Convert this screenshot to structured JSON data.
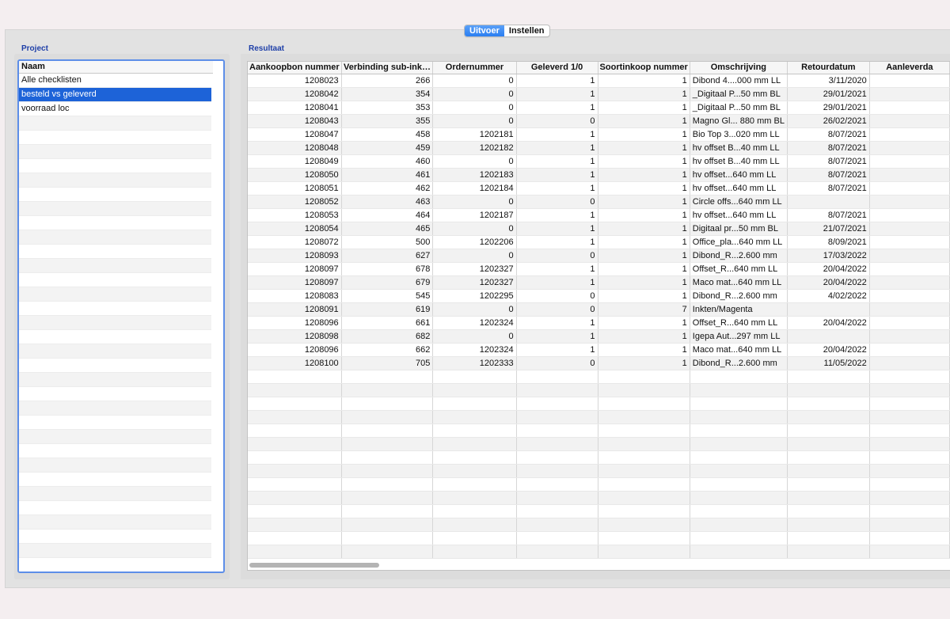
{
  "tabs": [
    {
      "label": "Uitvoer",
      "active": true
    },
    {
      "label": "Instellen",
      "active": false
    }
  ],
  "project": {
    "title": "Project",
    "column_header": "Naam",
    "items": [
      "Alle checklisten",
      "besteld vs geleverd",
      "voorraad loc"
    ],
    "selected_index": 1
  },
  "result": {
    "title": "Resultaat",
    "columns": [
      "Aankoopbon nummer",
      "Verbinding sub-ink…",
      "Ordernummer",
      "Geleverd 1/0",
      "Soortinkoop nummer",
      "Omschrijving",
      "Retourdatum",
      "Aanleverda"
    ],
    "rows": [
      [
        "1208023",
        "266",
        "0",
        "1",
        "1",
        "Dibond 4....000 mm LL",
        "3/11/2020",
        ""
      ],
      [
        "1208042",
        "354",
        "0",
        "1",
        "1",
        "_Digitaal P...50 mm BL",
        "29/01/2021",
        ""
      ],
      [
        "1208041",
        "353",
        "0",
        "1",
        "1",
        "_Digitaal P...50 mm BL",
        "29/01/2021",
        ""
      ],
      [
        "1208043",
        "355",
        "0",
        "0",
        "1",
        "Magno Gl... 880 mm BL",
        "26/02/2021",
        ""
      ],
      [
        "1208047",
        "458",
        "1202181",
        "1",
        "1",
        "Bio Top 3...020 mm LL",
        "8/07/2021",
        ""
      ],
      [
        "1208048",
        "459",
        "1202182",
        "1",
        "1",
        "hv offset B...40 mm LL",
        "8/07/2021",
        ""
      ],
      [
        "1208049",
        "460",
        "0",
        "1",
        "1",
        "hv offset B...40 mm LL",
        "8/07/2021",
        ""
      ],
      [
        "1208050",
        "461",
        "1202183",
        "1",
        "1",
        "hv offset...640 mm LL",
        "8/07/2021",
        ""
      ],
      [
        "1208051",
        "462",
        "1202184",
        "1",
        "1",
        "hv offset...640 mm LL",
        "8/07/2021",
        ""
      ],
      [
        "1208052",
        "463",
        "0",
        "0",
        "1",
        "Circle offs...640 mm LL",
        "",
        ""
      ],
      [
        "1208053",
        "464",
        "1202187",
        "1",
        "1",
        "hv offset...640 mm LL",
        "8/07/2021",
        ""
      ],
      [
        "1208054",
        "465",
        "0",
        "1",
        "1",
        "Digitaal pr...50 mm BL",
        "21/07/2021",
        ""
      ],
      [
        "1208072",
        "500",
        "1202206",
        "1",
        "1",
        "Office_pla...640 mm LL",
        "8/09/2021",
        ""
      ],
      [
        "1208093",
        "627",
        "0",
        "0",
        "1",
        "Dibond_R...2.600 mm",
        "17/03/2022",
        ""
      ],
      [
        "1208097",
        "678",
        "1202327",
        "1",
        "1",
        "Offset_R...640 mm LL",
        "20/04/2022",
        ""
      ],
      [
        "1208097",
        "679",
        "1202327",
        "1",
        "1",
        "Maco mat...640 mm LL",
        "20/04/2022",
        ""
      ],
      [
        "1208083",
        "545",
        "1202295",
        "0",
        "1",
        "Dibond_R...2.600 mm",
        "4/02/2022",
        ""
      ],
      [
        "1208091",
        "619",
        "0",
        "0",
        "7",
        "Inkten/Magenta",
        "",
        ""
      ],
      [
        "1208096",
        "661",
        "1202324",
        "1",
        "1",
        "Offset_R...640 mm LL",
        "20/04/2022",
        ""
      ],
      [
        "1208098",
        "682",
        "0",
        "1",
        "1",
        "Igepa Aut...297 mm LL",
        "",
        ""
      ],
      [
        "1208096",
        "662",
        "1202324",
        "1",
        "1",
        "Maco mat...640 mm LL",
        "20/04/2022",
        ""
      ],
      [
        "1208100",
        "705",
        "1202333",
        "0",
        "1",
        "Dibond_R...2.600 mm",
        "11/05/2022",
        ""
      ]
    ]
  },
  "colors": {
    "accent": "#2a7ef1",
    "selection": "#1d63d8",
    "section_title": "#1e3fa8",
    "focus_ring": "#5d8ee8"
  }
}
